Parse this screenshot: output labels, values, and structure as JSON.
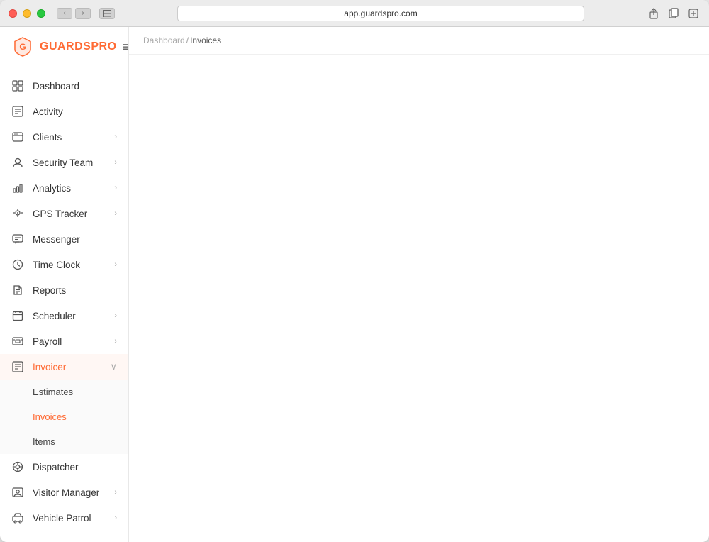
{
  "window": {
    "url": "app.guardspro.com"
  },
  "logo": {
    "brand_first": "GUARDS",
    "brand_second": "PRO"
  },
  "breadcrumb": {
    "parent": "Dashboard",
    "separator": "/",
    "current": "Invoices"
  },
  "nav": {
    "items": [
      {
        "id": "dashboard",
        "label": "Dashboard",
        "icon": "grid",
        "hasChevron": false
      },
      {
        "id": "activity",
        "label": "Activity",
        "icon": "activity",
        "hasChevron": false
      },
      {
        "id": "clients",
        "label": "Clients",
        "icon": "monitor",
        "hasChevron": true
      },
      {
        "id": "security-team",
        "label": "Security Team",
        "icon": "person",
        "hasChevron": true
      },
      {
        "id": "analytics",
        "label": "Analytics",
        "icon": "bar-chart",
        "hasChevron": true
      },
      {
        "id": "gps-tracker",
        "label": "GPS Tracker",
        "icon": "location",
        "hasChevron": true
      },
      {
        "id": "messenger",
        "label": "Messenger",
        "icon": "message",
        "hasChevron": false
      },
      {
        "id": "time-clock",
        "label": "Time Clock",
        "icon": "clock",
        "hasChevron": true
      },
      {
        "id": "reports",
        "label": "Reports",
        "icon": "file",
        "hasChevron": false
      },
      {
        "id": "scheduler",
        "label": "Scheduler",
        "icon": "calendar",
        "hasChevron": true
      },
      {
        "id": "payroll",
        "label": "Payroll",
        "icon": "payroll",
        "hasChevron": true
      },
      {
        "id": "invoicer",
        "label": "Invoicer",
        "icon": "invoice",
        "hasChevron": false,
        "expanded": true
      },
      {
        "id": "dispatcher",
        "label": "Dispatcher",
        "icon": "dispatch",
        "hasChevron": false
      },
      {
        "id": "visitor-manager",
        "label": "Visitor Manager",
        "icon": "visitor",
        "hasChevron": true
      },
      {
        "id": "vehicle-patrol",
        "label": "Vehicle Patrol",
        "icon": "vehicle",
        "hasChevron": true
      }
    ],
    "invoicer_sub": [
      {
        "id": "estimates",
        "label": "Estimates",
        "active": false
      },
      {
        "id": "invoices",
        "label": "Invoices",
        "active": true
      },
      {
        "id": "items",
        "label": "Items",
        "active": false
      }
    ]
  },
  "icons": {
    "grid": "⊞",
    "activity": "▦",
    "chevron_right": "›",
    "chevron_down": "⌄",
    "hamburger": "≡"
  }
}
